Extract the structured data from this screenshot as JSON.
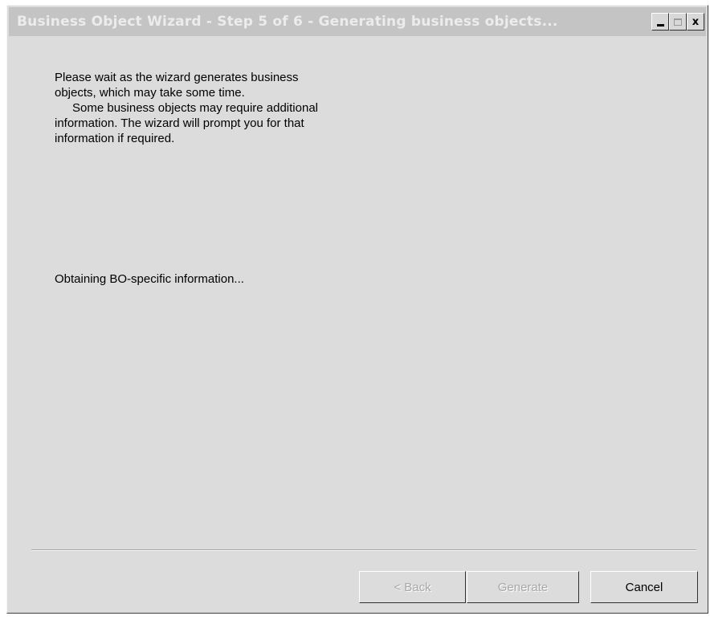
{
  "window": {
    "title": "Business Object Wizard - Step 5 of 6 - Generating business objects...",
    "buttons": {
      "minimize_icon": "minimize-icon",
      "maximize_icon": "maximize-icon",
      "close_icon": "close-icon",
      "close_glyph": "x"
    }
  },
  "content": {
    "intro_paragraph_1": "Please wait as the wizard generates business objects, which may take some time.",
    "intro_paragraph_2": "Some business objects may require additional information. The wizard will prompt you for that information if required.",
    "status_text": "Obtaining BO-specific information..."
  },
  "footer": {
    "back_label": "< Back",
    "generate_label": "Generate",
    "cancel_label": "Cancel",
    "back_enabled": false,
    "generate_enabled": false,
    "cancel_enabled": true
  },
  "colors": {
    "window_bg": "#dcdcdc",
    "titlebar_bg": "#c4c4c4",
    "disabled_text": "#a8a8a8"
  }
}
